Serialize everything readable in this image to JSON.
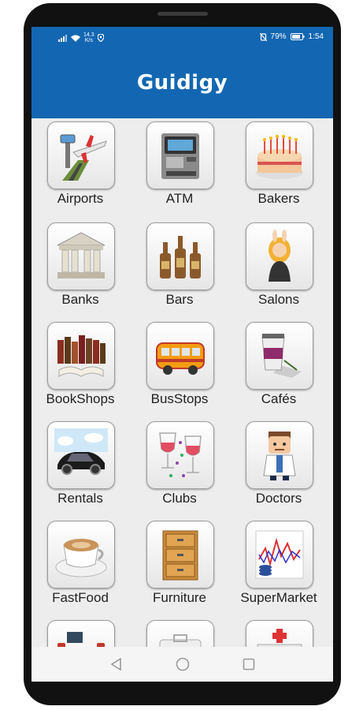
{
  "status_bar": {
    "signal_icon": "signal-icon",
    "wifi_icon": "wifi-icon",
    "speed_value": "14.3",
    "speed_unit": "K/s",
    "location_icon": "location-icon",
    "mute_icon": "vibrate-off-icon",
    "battery_percent": "79%",
    "battery_icon": "battery-icon",
    "time": "1:54"
  },
  "app": {
    "title": "Guidigy"
  },
  "categories": [
    {
      "label": "Airports",
      "icon": "airport-icon"
    },
    {
      "label": "ATM",
      "icon": "atm-icon"
    },
    {
      "label": "Bakers",
      "icon": "cake-icon"
    },
    {
      "label": "Banks",
      "icon": "bank-icon"
    },
    {
      "label": "Bars",
      "icon": "beer-bottles-icon"
    },
    {
      "label": "Salons",
      "icon": "salon-woman-icon"
    },
    {
      "label": "BookShops",
      "icon": "books-icon"
    },
    {
      "label": "BusStops",
      "icon": "bus-icon"
    },
    {
      "label": "Cafés",
      "icon": "coffee-cup-icon"
    },
    {
      "label": "Rentals",
      "icon": "car-icon"
    },
    {
      "label": "Clubs",
      "icon": "wine-glasses-icon"
    },
    {
      "label": "Doctors",
      "icon": "doctor-icon"
    },
    {
      "label": "FastFood",
      "icon": "coffee-plate-icon"
    },
    {
      "label": "Furniture",
      "icon": "cabinet-icon"
    },
    {
      "label": "SuperMarket",
      "icon": "market-chart-icon"
    },
    {
      "label": "",
      "icon": "dumbbell-icon"
    },
    {
      "label": "",
      "icon": "medical-kit-icon"
    },
    {
      "label": "",
      "icon": "hospital-icon"
    }
  ],
  "nav_bar": {
    "back_icon": "back-triangle-icon",
    "home_icon": "home-circle-icon",
    "recents_icon": "recents-square-icon"
  }
}
